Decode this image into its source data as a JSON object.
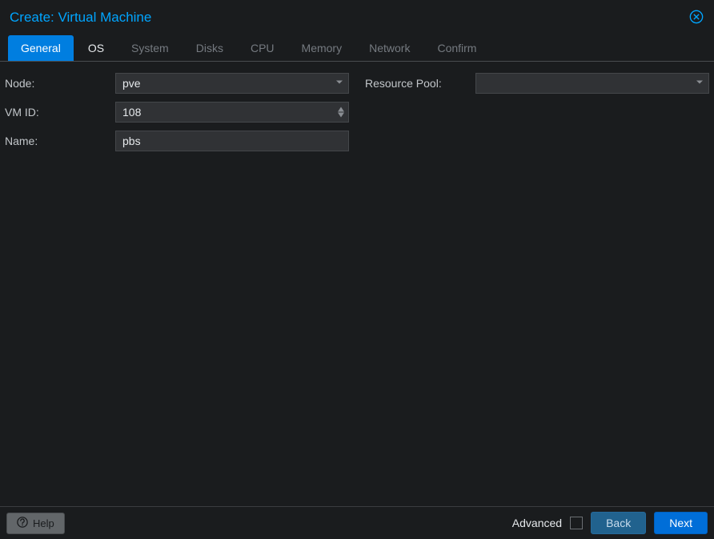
{
  "header": {
    "title": "Create: Virtual Machine"
  },
  "tabs": [
    {
      "key": "general",
      "label": "General",
      "active": true,
      "enabled": true
    },
    {
      "key": "os",
      "label": "OS",
      "active": false,
      "enabled": true
    },
    {
      "key": "system",
      "label": "System",
      "active": false,
      "enabled": false
    },
    {
      "key": "disks",
      "label": "Disks",
      "active": false,
      "enabled": false
    },
    {
      "key": "cpu",
      "label": "CPU",
      "active": false,
      "enabled": false
    },
    {
      "key": "memory",
      "label": "Memory",
      "active": false,
      "enabled": false
    },
    {
      "key": "network",
      "label": "Network",
      "active": false,
      "enabled": false
    },
    {
      "key": "confirm",
      "label": "Confirm",
      "active": false,
      "enabled": false
    }
  ],
  "form": {
    "node": {
      "label": "Node:",
      "value": "pve"
    },
    "vmid": {
      "label": "VM ID:",
      "value": "108"
    },
    "name": {
      "label": "Name:",
      "value": "pbs"
    },
    "resource_pool": {
      "label": "Resource Pool:",
      "value": ""
    }
  },
  "footer": {
    "help": "Help",
    "advanced": "Advanced",
    "advanced_checked": false,
    "back": "Back",
    "next": "Next"
  }
}
